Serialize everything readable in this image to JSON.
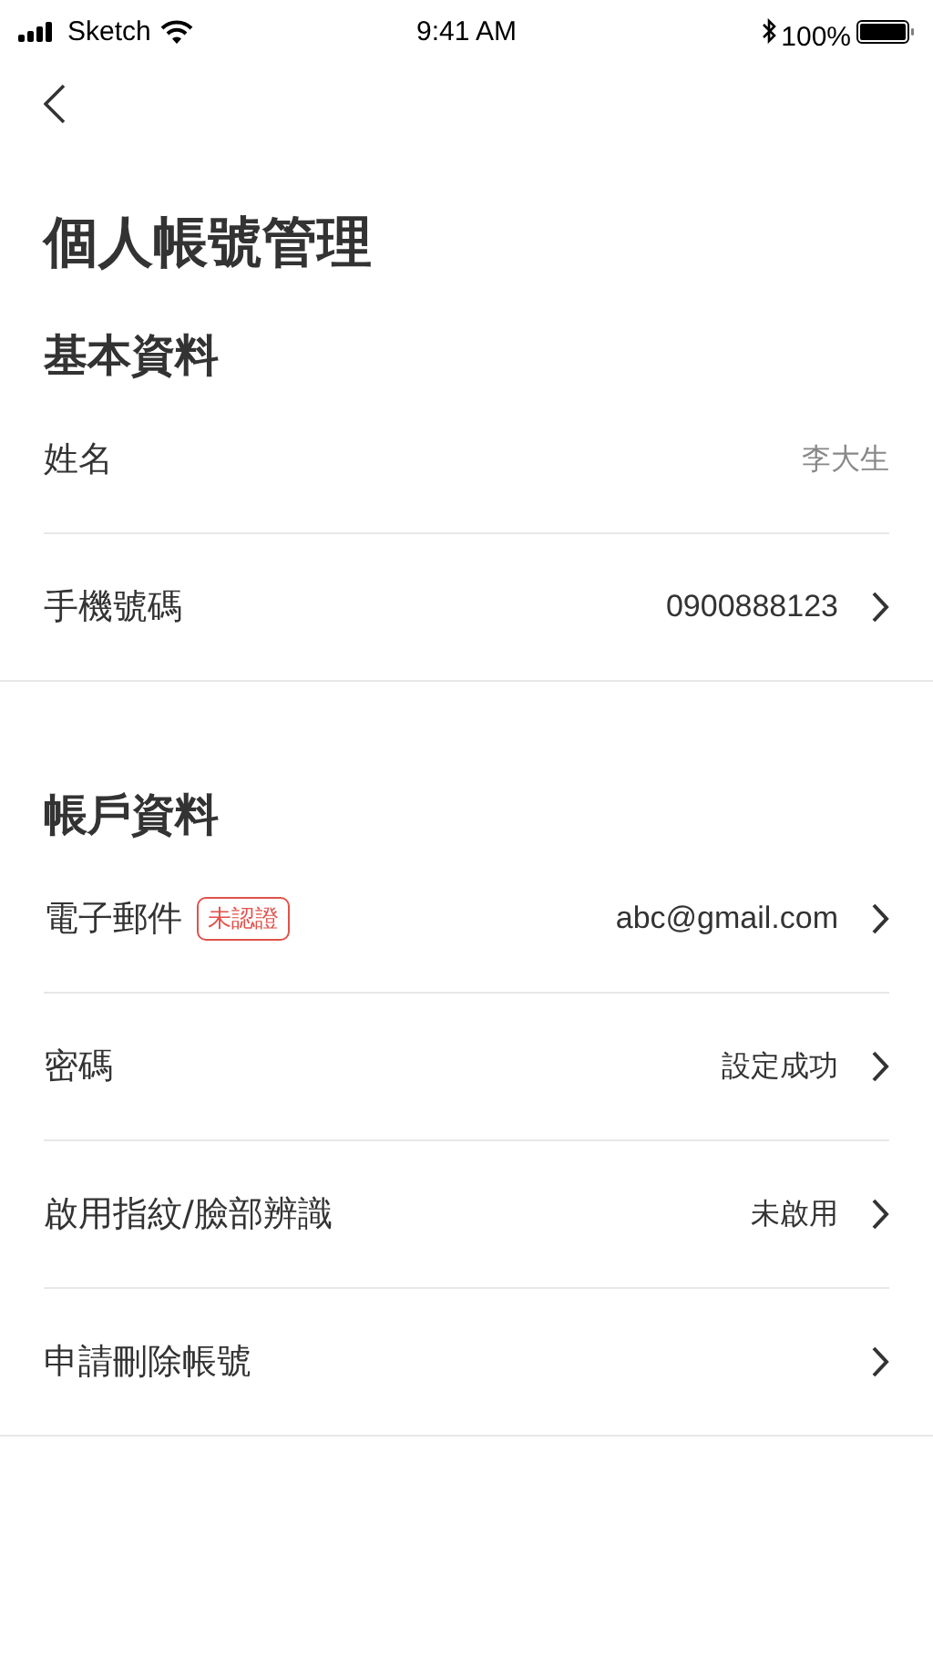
{
  "status_bar": {
    "carrier": "Sketch",
    "time": "9:41 AM",
    "battery": "100%"
  },
  "page": {
    "title": "個人帳號管理"
  },
  "sections": [
    {
      "title": "基本資料",
      "rows": [
        {
          "label": "姓名",
          "value": "李大生",
          "chevron": false
        },
        {
          "label": "手機號碼",
          "value": "0900888123",
          "chevron": true
        }
      ]
    },
    {
      "title": "帳戶資料",
      "rows": [
        {
          "label": "電子郵件",
          "badge": "未認證",
          "value": "abc@gmail.com",
          "chevron": true
        },
        {
          "label": "密碼",
          "value": "設定成功",
          "chevron": true
        },
        {
          "label": "啟用指紋/臉部辨識",
          "value": "未啟用",
          "chevron": true
        },
        {
          "label": "申請刪除帳號",
          "chevron": true
        }
      ]
    }
  ]
}
